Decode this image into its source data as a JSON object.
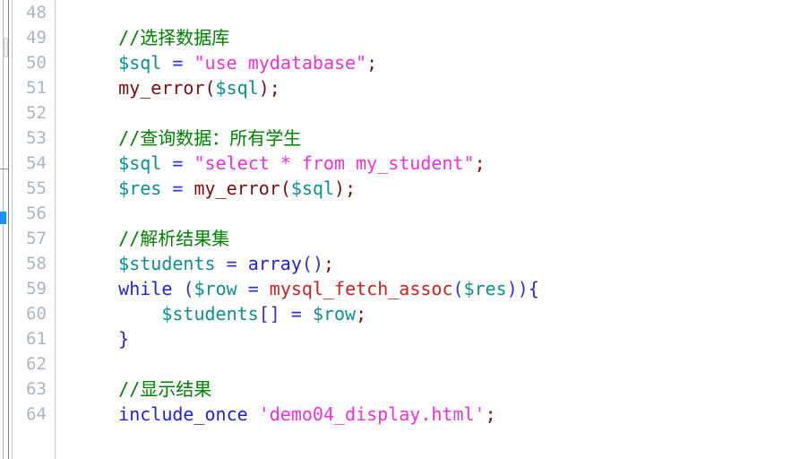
{
  "editor": {
    "language": "php",
    "background_color": "#ffffff",
    "gutter_color": "#aeb4bd",
    "first_line_number": 48,
    "last_line_number": 64
  },
  "colors": {
    "comment": "#008000",
    "variable": "#0b8f91",
    "operator": "#3333cc",
    "string": "#ee33dd",
    "function": "#7a0e0e",
    "builtin_function": "#cc2222",
    "keyword": "#2222dd",
    "brace": "#2222dd",
    "line_number": "#aeb4bd",
    "marker": "#1e90ff"
  },
  "line_numbers": [
    "48",
    "49",
    "50",
    "51",
    "52",
    "53",
    "54",
    "55",
    "56",
    "57",
    "58",
    "59",
    "60",
    "61",
    "62",
    "63",
    "64"
  ],
  "lines": [
    {
      "number": "48",
      "tokens": []
    },
    {
      "number": "49",
      "tokens": [
        {
          "text": "    ",
          "kind": "plain"
        },
        {
          "text": "//选择数据库",
          "kind": "comment"
        }
      ]
    },
    {
      "number": "50",
      "tokens": [
        {
          "text": "    ",
          "kind": "plain"
        },
        {
          "text": "$sql",
          "kind": "var"
        },
        {
          "text": " ",
          "kind": "plain"
        },
        {
          "text": "=",
          "kind": "op"
        },
        {
          "text": " ",
          "kind": "plain"
        },
        {
          "text": "\"use mydatabase\"",
          "kind": "string"
        },
        {
          "text": ";",
          "kind": "punct"
        }
      ]
    },
    {
      "number": "51",
      "tokens": [
        {
          "text": "    ",
          "kind": "plain"
        },
        {
          "text": "my_error",
          "kind": "func"
        },
        {
          "text": "(",
          "kind": "punct"
        },
        {
          "text": "$sql",
          "kind": "var"
        },
        {
          "text": ")",
          "kind": "punct"
        },
        {
          "text": ";",
          "kind": "punct"
        }
      ]
    },
    {
      "number": "52",
      "tokens": []
    },
    {
      "number": "53",
      "tokens": [
        {
          "text": "    ",
          "kind": "plain"
        },
        {
          "text": "//查询数据：所有学生",
          "kind": "comment"
        }
      ]
    },
    {
      "number": "54",
      "tokens": [
        {
          "text": "    ",
          "kind": "plain"
        },
        {
          "text": "$sql",
          "kind": "var"
        },
        {
          "text": " ",
          "kind": "plain"
        },
        {
          "text": "=",
          "kind": "op"
        },
        {
          "text": " ",
          "kind": "plain"
        },
        {
          "text": "\"select * from my_student\"",
          "kind": "string"
        },
        {
          "text": ";",
          "kind": "punct"
        }
      ]
    },
    {
      "number": "55",
      "tokens": [
        {
          "text": "    ",
          "kind": "plain"
        },
        {
          "text": "$res",
          "kind": "var"
        },
        {
          "text": " ",
          "kind": "plain"
        },
        {
          "text": "=",
          "kind": "op"
        },
        {
          "text": " ",
          "kind": "plain"
        },
        {
          "text": "my_error",
          "kind": "func"
        },
        {
          "text": "(",
          "kind": "punct"
        },
        {
          "text": "$sql",
          "kind": "var"
        },
        {
          "text": ")",
          "kind": "punct"
        },
        {
          "text": ";",
          "kind": "punct"
        }
      ]
    },
    {
      "number": "56",
      "tokens": []
    },
    {
      "number": "57",
      "tokens": [
        {
          "text": "    ",
          "kind": "plain"
        },
        {
          "text": "//解析结果集",
          "kind": "comment"
        }
      ]
    },
    {
      "number": "58",
      "tokens": [
        {
          "text": "    ",
          "kind": "plain"
        },
        {
          "text": "$students",
          "kind": "var"
        },
        {
          "text": " ",
          "kind": "plain"
        },
        {
          "text": "=",
          "kind": "op"
        },
        {
          "text": " ",
          "kind": "plain"
        },
        {
          "text": "array",
          "kind": "keyword"
        },
        {
          "text": "()",
          "kind": "op"
        },
        {
          "text": ";",
          "kind": "punct"
        }
      ]
    },
    {
      "number": "59",
      "tokens": [
        {
          "text": "    ",
          "kind": "plain"
        },
        {
          "text": "while",
          "kind": "keyword"
        },
        {
          "text": " ",
          "kind": "plain"
        },
        {
          "text": "(",
          "kind": "op"
        },
        {
          "text": "$row",
          "kind": "var"
        },
        {
          "text": " ",
          "kind": "plain"
        },
        {
          "text": "=",
          "kind": "op"
        },
        {
          "text": " ",
          "kind": "plain"
        },
        {
          "text": "mysql_fetch_assoc",
          "kind": "builtin"
        },
        {
          "text": "(",
          "kind": "op"
        },
        {
          "text": "$res",
          "kind": "var"
        },
        {
          "text": "))",
          "kind": "op"
        },
        {
          "text": "{",
          "kind": "brace"
        }
      ]
    },
    {
      "number": "60",
      "tokens": [
        {
          "text": "        ",
          "kind": "plain"
        },
        {
          "text": "$students",
          "kind": "var"
        },
        {
          "text": "[]",
          "kind": "op"
        },
        {
          "text": " ",
          "kind": "plain"
        },
        {
          "text": "=",
          "kind": "op"
        },
        {
          "text": " ",
          "kind": "plain"
        },
        {
          "text": "$row",
          "kind": "var"
        },
        {
          "text": ";",
          "kind": "punct"
        }
      ]
    },
    {
      "number": "61",
      "tokens": [
        {
          "text": "    ",
          "kind": "plain"
        },
        {
          "text": "}",
          "kind": "brace"
        }
      ]
    },
    {
      "number": "62",
      "tokens": []
    },
    {
      "number": "63",
      "tokens": [
        {
          "text": "    ",
          "kind": "plain"
        },
        {
          "text": "//显示结果",
          "kind": "comment"
        }
      ]
    },
    {
      "number": "64",
      "tokens": [
        {
          "text": "    ",
          "kind": "plain"
        },
        {
          "text": "include_once",
          "kind": "keyword"
        },
        {
          "text": " ",
          "kind": "plain"
        },
        {
          "text": "'demo04_display.html'",
          "kind": "string"
        },
        {
          "text": ";",
          "kind": "punct"
        }
      ]
    }
  ]
}
